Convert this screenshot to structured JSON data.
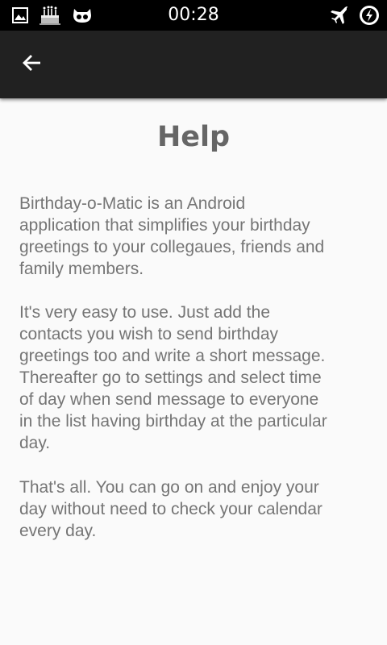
{
  "status_bar": {
    "time": "00:28",
    "icons": [
      "image-icon",
      "birthday-cake-icon",
      "cyanogen-mascot-icon",
      "airplane-mode-icon",
      "battery-charging-icon"
    ]
  },
  "app_bar": {
    "back_icon": "arrow-left-icon"
  },
  "help": {
    "title": "Help",
    "paragraphs": [
      "Birthday-o-Matic is an Android\napplication that simplifies your birthday\ngreetings to your collegaues, friends and\nfamily members.",
      "It's very easy to use. Just add the\ncontacts you wish to send birthday\ngreetings too and write a short message.\nThereafter go to settings and select time\nof day when send message to everyone\nin the list having birthday at the particular\nday.",
      "That's all. You can go on and enjoy your\nday without need to check your calendar\nevery day."
    ]
  },
  "colors": {
    "status_bar": "#000000",
    "app_bar": "#212121",
    "background": "#fafafa",
    "title": "#666666",
    "body_text": "#757575"
  }
}
